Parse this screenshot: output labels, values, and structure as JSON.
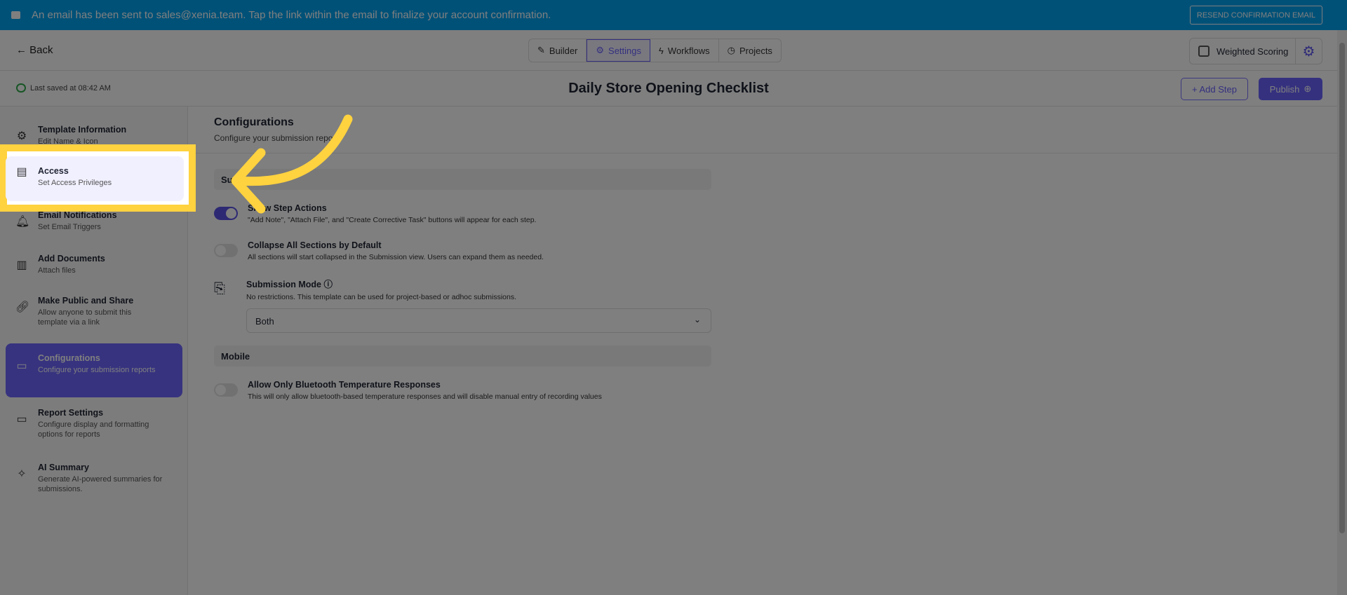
{
  "banner": {
    "message": "An email has been sent to sales@xenia.team. Tap the link within the email to finalize your account confirmation.",
    "resend": "RESEND CONFIRMATION EMAIL"
  },
  "header": {
    "back": "Back",
    "tabs": [
      {
        "label": "Builder",
        "icon": "pencil-icon"
      },
      {
        "label": "Settings",
        "icon": "gear-icon"
      },
      {
        "label": "Workflows",
        "icon": "lightning-icon"
      },
      {
        "label": "Projects",
        "icon": "clock-icon"
      }
    ],
    "weighted_scoring": "Weighted Scoring"
  },
  "toolbar": {
    "last_saved": "Last saved at 08:42 AM",
    "title": "Daily Store Opening Checklist",
    "add_step": "+ Add Step",
    "publish": "Publish"
  },
  "sidebar": {
    "items": [
      {
        "title": "Template Information",
        "sub": "Edit Name & Icon"
      },
      {
        "title": "Access",
        "sub": "Set Access Privileges"
      },
      {
        "title": "Email Notifications",
        "sub": "Set Email Triggers"
      },
      {
        "title": "Add Documents",
        "sub": "Attach files"
      },
      {
        "title": "Make Public and Share",
        "sub": "Allow anyone to submit this template via a link"
      },
      {
        "title": "Configurations",
        "sub": "Configure your submission reports"
      },
      {
        "title": "Report Settings",
        "sub": "Configure display and formatting options for reports"
      },
      {
        "title": "AI Summary",
        "sub": "Generate AI-powered summaries for submissions."
      }
    ]
  },
  "main": {
    "title": "Configurations",
    "desc": "Configure your submission reports",
    "section1": "Su",
    "options": [
      {
        "title": "Show Step Actions",
        "desc": "\"Add Note\", \"Attach File\", and \"Create Corrective Task\" buttons will appear for each step.",
        "on": true
      },
      {
        "title": "Collapse All Sections by Default",
        "desc": "All sections will start collapsed in the Submission view. Users can expand them as needed.",
        "on": false
      }
    ],
    "submission_mode": {
      "title": "Submission Mode",
      "desc": "No restrictions. This template can be used for project-based or adhoc submissions.",
      "value": "Both"
    },
    "section2": "Mobile",
    "bluetooth": {
      "title": "Allow Only Bluetooth Temperature Responses",
      "desc": "This will only allow bluetooth-based temperature responses and will disable manual entry of recording values",
      "on": false
    }
  },
  "colors": {
    "accent": "#6b63ff",
    "banner": "#00a2f0",
    "highlight": "#ffd23f"
  }
}
